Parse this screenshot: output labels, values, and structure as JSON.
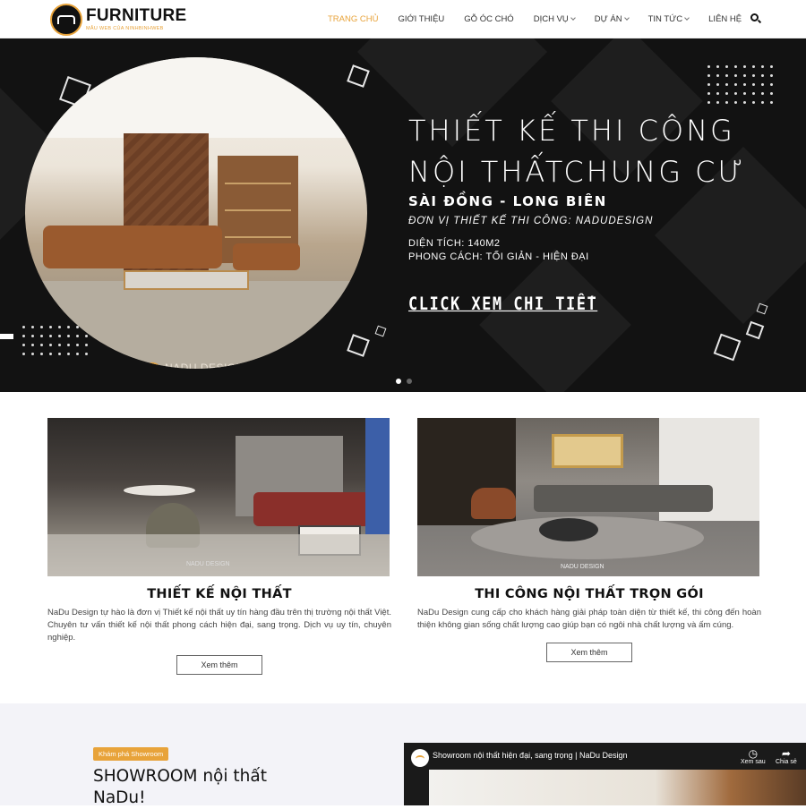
{
  "header": {
    "logo_text": "FURNITURE",
    "logo_sub": "MẪU WEB CỦA NINHBINHWEB",
    "nav": [
      {
        "label": "TRANG CHỦ",
        "active": true,
        "dropdown": false
      },
      {
        "label": "GIỚI THIỆU",
        "active": false,
        "dropdown": false
      },
      {
        "label": "GỖ ÓC CHÓ",
        "active": false,
        "dropdown": false
      },
      {
        "label": "DỊCH VỤ",
        "active": false,
        "dropdown": true
      },
      {
        "label": "DỰ ÁN",
        "active": false,
        "dropdown": true
      },
      {
        "label": "TIN TỨC",
        "active": false,
        "dropdown": true
      },
      {
        "label": "LIÊN HỆ",
        "active": false,
        "dropdown": false
      }
    ],
    "search_icon": "search-icon"
  },
  "hero": {
    "title_line1": "THIẾT KẾ THI CÔNG",
    "title_line2": "NỘI THẤTCHUNG CƯ",
    "subtitle": "SÀI ĐỒNG - LONG BIÊN",
    "unit": "ĐƠN VỊ THIẾT KẾ THI CÔNG: NADUDESIGN",
    "area": "DIỆN TÍCH: 140M2",
    "style": "PHONG CÁCH: TỐI GIẢN - HIỆN ĐẠI",
    "cta": "CLICK XEM CHI TIẾT",
    "watermark": "NADU DESIGN",
    "slides": 2,
    "active_slide": 1
  },
  "services": [
    {
      "title": "THIẾT KẾ NỘI THẤT",
      "text": "NaDu Design tự hào là đơn vị Thiết kế nội thất uy tín hàng đầu trên thị trường nội thất Việt. Chuyên tư vấn thiết kế nội thất phong cách hiện đại, sang trọng. Dịch vụ uy tín, chuyên nghiệp.",
      "button": "Xem thêm",
      "image_watermark": "NADU DESIGN"
    },
    {
      "title": "THI CÔNG NỘI THẤT TRỌN GÓI",
      "text": "NaDu Design cung cấp cho khách hàng giải pháp toàn diện từ thiết kế, thi công đến hoàn thiện không gian sống chất lượng cao giúp bạn có ngôi nhà chất lượng và ấm cúng.",
      "button": "Xem thêm",
      "image_watermark": "NADU DESIGN"
    }
  ],
  "showroom": {
    "tag": "Khám phá Showroom",
    "title": "SHOWROOM nội thất NaDu!",
    "video": {
      "title": "Showroom nội thất hiện đại, sang trọng | NaDu Design",
      "watch_later": "Xem sau",
      "share": "Chia sẻ"
    }
  },
  "colors": {
    "accent": "#e8a33a",
    "hero_bg": "#121212",
    "showroom_bg": "#f3f3f8"
  }
}
